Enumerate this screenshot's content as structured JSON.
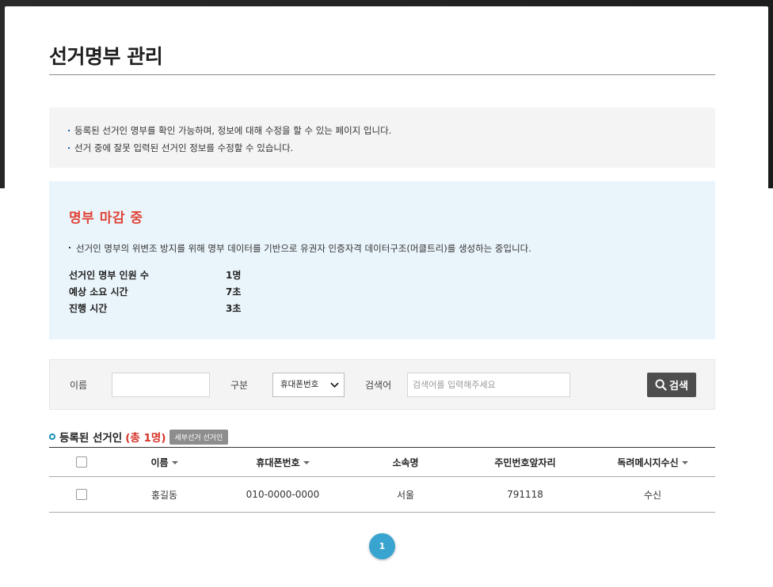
{
  "page_title": "선거명부 관리",
  "info": {
    "lines": [
      "등록된 선거인 명부를 확인 가능하며, 정보에 대해 수정을 할 수 있는 페이지 입니다.",
      "선거 중에 잘못 입력된 선거인 정보를 수정할 수 있습니다."
    ]
  },
  "status": {
    "title": "명부 마감 중",
    "description": "선거인 명부의 위변조 방지를 위해 명부 데이터를 기반으로 유권자 인증자격 데이터구조(머클트리)를 생성하는 중입니다.",
    "stats": [
      {
        "label": "선거인 명부 인원 수",
        "value": "1명"
      },
      {
        "label": "예상 소요 시간",
        "value": "7초"
      },
      {
        "label": "진행 시간",
        "value": "3초"
      }
    ]
  },
  "search": {
    "name_label": "이름",
    "name_value": "",
    "category_label": "구분",
    "category_selected": "휴대폰번호",
    "keyword_label": "검색어",
    "keyword_placeholder": "검색어를 입력해주세요",
    "button_label": "검색"
  },
  "list": {
    "title": "등록된 선거인",
    "count_text": "(총 1명)",
    "detail_button": "세부선거 선거인",
    "columns": [
      "이름",
      "휴대폰번호",
      "소속명",
      "주민번호앞자리",
      "독려메시지수신"
    ],
    "rows": [
      {
        "name": "홍길동",
        "phone": "010-0000-0000",
        "org": "서울",
        "id_front": "791118",
        "message": "수신"
      }
    ]
  },
  "pagination": {
    "current": "1"
  },
  "colors": {
    "accent": "#38a4cf",
    "alert": "#e0453a",
    "status_bg": "#eaf5fb"
  }
}
